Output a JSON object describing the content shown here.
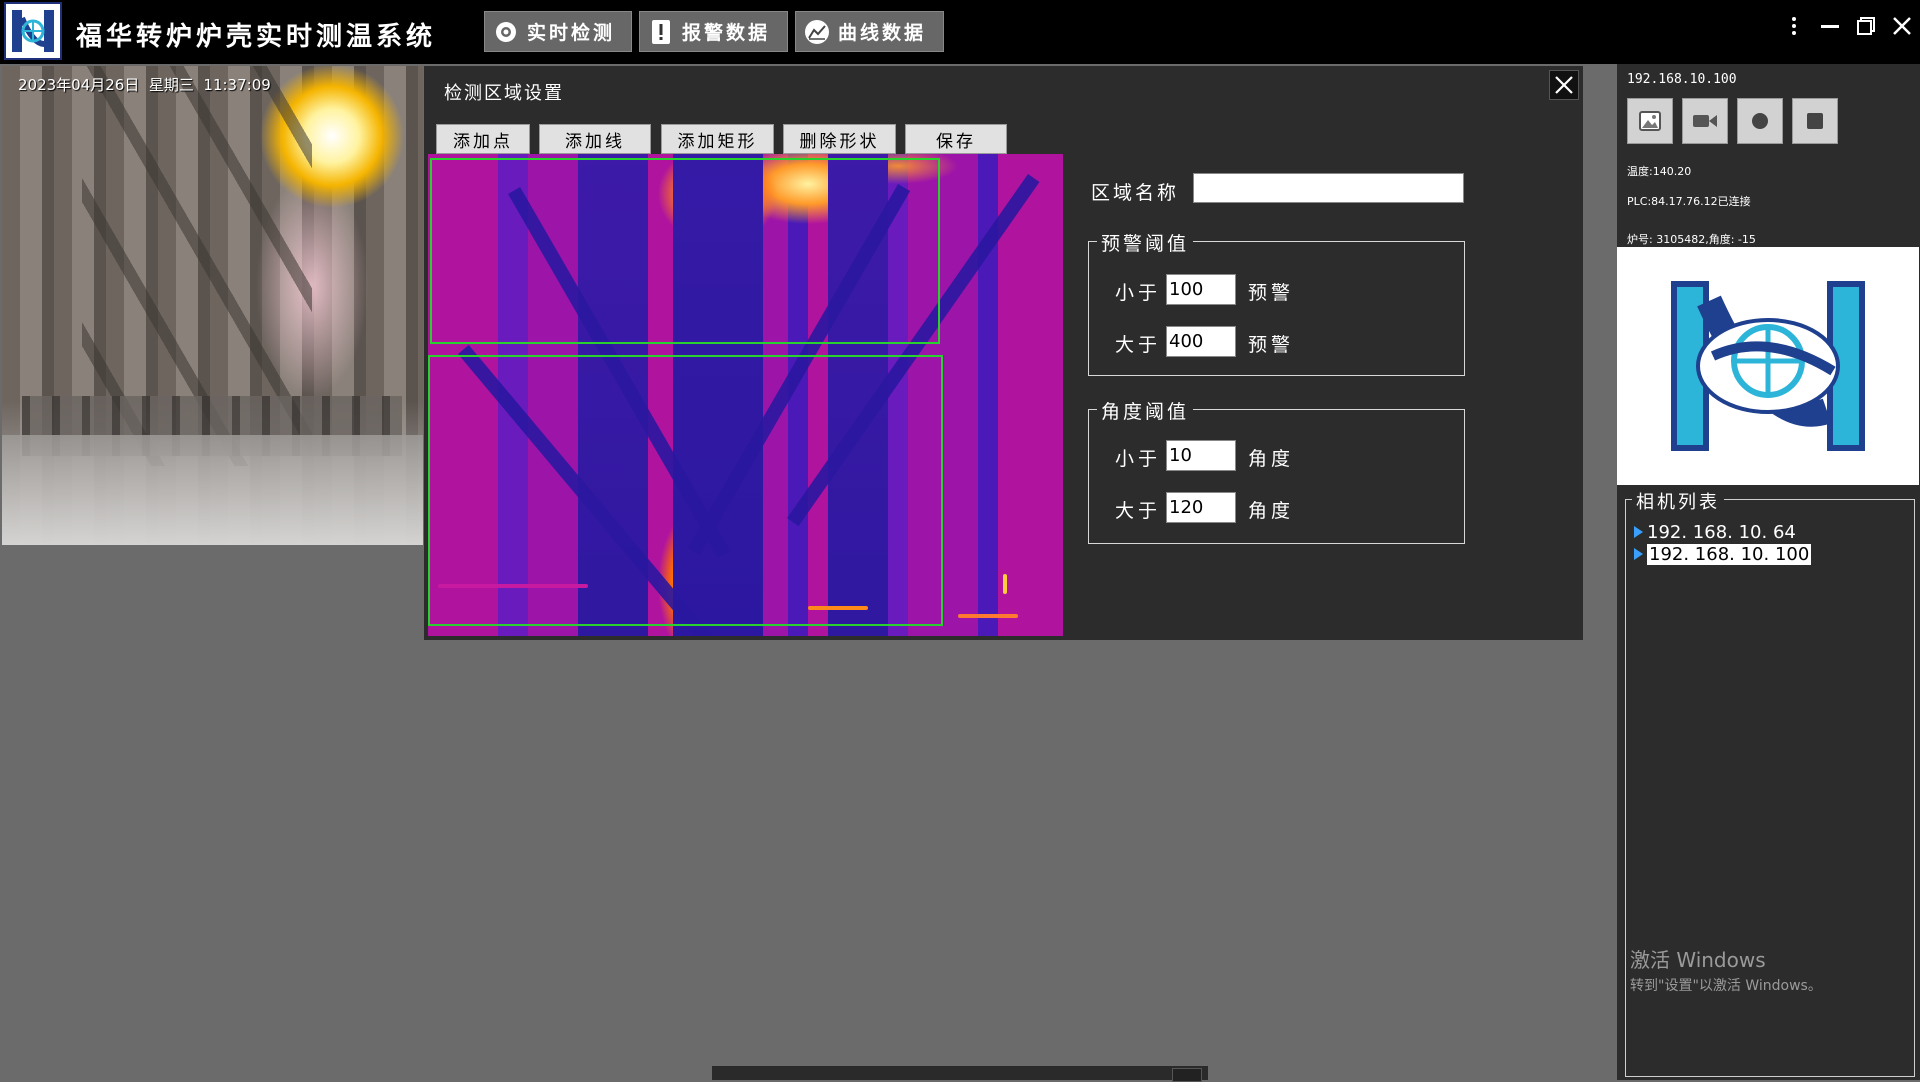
{
  "app": {
    "title": "福华转炉炉壳实时测温系统",
    "nav": [
      {
        "label": "实时检测",
        "icon": "camera-lens-icon"
      },
      {
        "label": "报警数据",
        "icon": "alert-icon"
      },
      {
        "label": "曲线数据",
        "icon": "line-chart-icon"
      }
    ],
    "window_controls": [
      "more-icon",
      "minimize-icon",
      "maximize-icon",
      "close-icon"
    ]
  },
  "live_view": {
    "timestamp": "2023年04月26日  星期三  11:37:09"
  },
  "dialog": {
    "title": "检测区域设置",
    "toolbar": [
      "添加点",
      "添加线",
      "添加矩形",
      "删除形状",
      "保存"
    ],
    "zone_name_label": "区域名称",
    "zone_name_value": "",
    "warning_group": {
      "title": "预警阈值",
      "less_label": "小于",
      "less_value": "100",
      "less_unit": "预警",
      "greater_label": "大于",
      "greater_value": "400",
      "greater_unit": "预警"
    },
    "angle_group": {
      "title": "角度阈值",
      "less_label": "小于",
      "less_value": "10",
      "less_unit": "角度",
      "greater_label": "大于",
      "greater_value": "120",
      "greater_unit": "角度"
    }
  },
  "right_panel": {
    "ip": "192.168.10.100",
    "buttons": [
      "image-icon",
      "video-camera-icon",
      "record-icon",
      "stop-icon"
    ],
    "temperature": "温度:140.20",
    "plc": "PLC:84.17.76.12已连接",
    "furnace": "炉号: 3105482,角度: -15",
    "camera_list_title": "相机列表",
    "cameras": [
      "192. 168. 10. 64",
      "192. 168. 10. 100"
    ],
    "selected_camera": 1
  },
  "watermark": {
    "line1": "激活 Windows",
    "line2": "转到\"设置\"以激活 Windows。"
  },
  "colors": {
    "roi": "#29d12f",
    "topbar": "#000000",
    "panel": "#2c2c2c",
    "background": "#6b6b6b"
  }
}
